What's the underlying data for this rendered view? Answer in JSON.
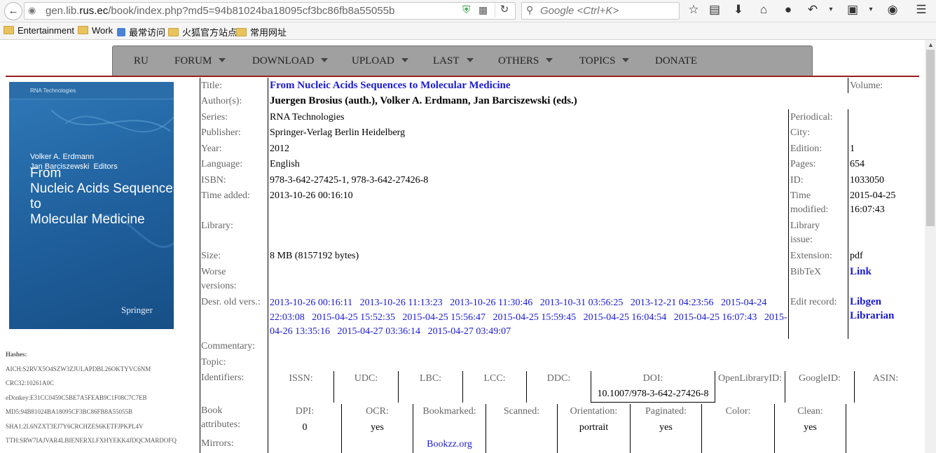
{
  "browser": {
    "url_prefix": "gen.lib.",
    "url_domain": "rus.ec",
    "url_path": "/book/index.php?md5=94b81024ba18095cf3bc86fb8a55055b",
    "search_placeholder": "Google <Ctrl+K>"
  },
  "bookmarks": [
    "Entertainment",
    "Work",
    "最常访问",
    "火狐官方站点",
    "常用网址"
  ],
  "menu": [
    "RU",
    "FORUM",
    "DOWNLOAD",
    "UPLOAD",
    "LAST",
    "OTHERS",
    "TOPICS",
    "DONATE"
  ],
  "cover": {
    "series": "RNA Technologies",
    "editors_line": "Volker A. Erdmann\nJan Barciszewski  Editors",
    "title_line": "From\nNucleic Acids Sequences\nto\nMolecular Medicine",
    "publisher": "Springer"
  },
  "hashes": {
    "heading": "Hashes:",
    "aich": "AICH:S2RVX5O4SZW3ZJULAPDBL26OKTYVC6NM",
    "crc32": "CRC32:10261A0C",
    "edonkey": "eDonkey:E31CC0459C5BE7A5FEAB9C1F08C7C7EB",
    "md5": "MD5:94B81024BA18095CF3BC86FB8A55055B",
    "sha1": "SHA1:2L6NZXT3EJ7Y6CRCHZES6KETFJPKPL4V",
    "tth": "TTH:SRW7IAJVAR4LBIENERXLFXHYEKK4JDQCMARDOFQ"
  },
  "labels": {
    "title": "Title:",
    "authors": "Author(s):",
    "series": "Series:",
    "publisher": "Publisher:",
    "year": "Year:",
    "language": "Language:",
    "isbn": "ISBN:",
    "time_added": "Time added:",
    "library": "Library:",
    "size": "Size:",
    "worse_1": "Worse",
    "worse_2": "versions:",
    "old_vers": "Desr. old vers.:",
    "commentary": "Commentary:",
    "topic": "Topic:",
    "identifiers": "Identifiers:",
    "book_attr_1": "Book",
    "book_attr_2": "attributes:",
    "mirrors": "Mirrors:",
    "volume": "Volume:",
    "periodical": "Periodical:",
    "city": "City:",
    "edition": "Edition:",
    "pages": "Pages:",
    "id": "ID:",
    "time_mod_1": "Time",
    "time_mod_2": "modified:",
    "lib_issue_1": "Library",
    "lib_issue_2": "issue:",
    "extension": "Extension:",
    "bibtex": "BibTeX",
    "edit_record": "Edit record:"
  },
  "book": {
    "title": "From Nucleic Acids Sequences to Molecular Medicine",
    "authors": "Juergen Brosius (auth.), Volker A. Erdmann, Jan Barciszewski (eds.)",
    "series": "RNA Technologies",
    "publisher": "Springer-Verlag Berlin Heidelberg",
    "year": "2012",
    "language": "English",
    "isbn": "978-3-642-27425-1, 978-3-642-27426-8",
    "time_added": "2013-10-26 00:16:10",
    "size": "8 MB (8157192 bytes)",
    "edition": "1",
    "pages": "654",
    "id": "1033050",
    "time_modified_date": "2015-04-25",
    "time_modified_time": "16:07:43",
    "extension": "pdf",
    "bibtex_link": "Link",
    "edit_link_1": "Libgen",
    "edit_link_2": "Librarian"
  },
  "old_versions": [
    "2013-10-26 00:16:11",
    "2013-10-26 11:13:23",
    "2013-10-26 11:30:46",
    "2013-10-31 03:56:25",
    "2013-12-21 04:23:56",
    "2015-04-24 22:03:08",
    "2015-04-25 15:52:35",
    "2015-04-25 15:56:47",
    "2015-04-25 15:59:45",
    "2015-04-25 16:04:54",
    "2015-04-25 16:07:43",
    "2015-04-26 13:35:16",
    "2015-04-27 03:36:14",
    "2015-04-27 03:49:07"
  ],
  "identifiers": {
    "issn": "ISSN:",
    "udc": "UDC:",
    "lbc": "LBC:",
    "lcc": "LCC:",
    "ddc": "DDC:",
    "doi": "DOI:",
    "doi_value": "10.1007/978-3-642-27426-8",
    "openlibrary": "OpenLibraryID:",
    "google": "GoogleID:",
    "asin": "ASIN:"
  },
  "attributes": {
    "dpi": "DPI:",
    "dpi_value": "0",
    "ocr": "OCR:",
    "ocr_value": "yes",
    "bookmarked": "Bookmarked:",
    "scanned": "Scanned:",
    "orientation": "Orientation:",
    "orientation_value": "portrait",
    "paginated": "Paginated:",
    "paginated_value": "yes",
    "color": "Color:",
    "clean": "Clean:",
    "clean_value": "yes"
  },
  "mirrors": {
    "bookzz": "Bookzz.org"
  }
}
